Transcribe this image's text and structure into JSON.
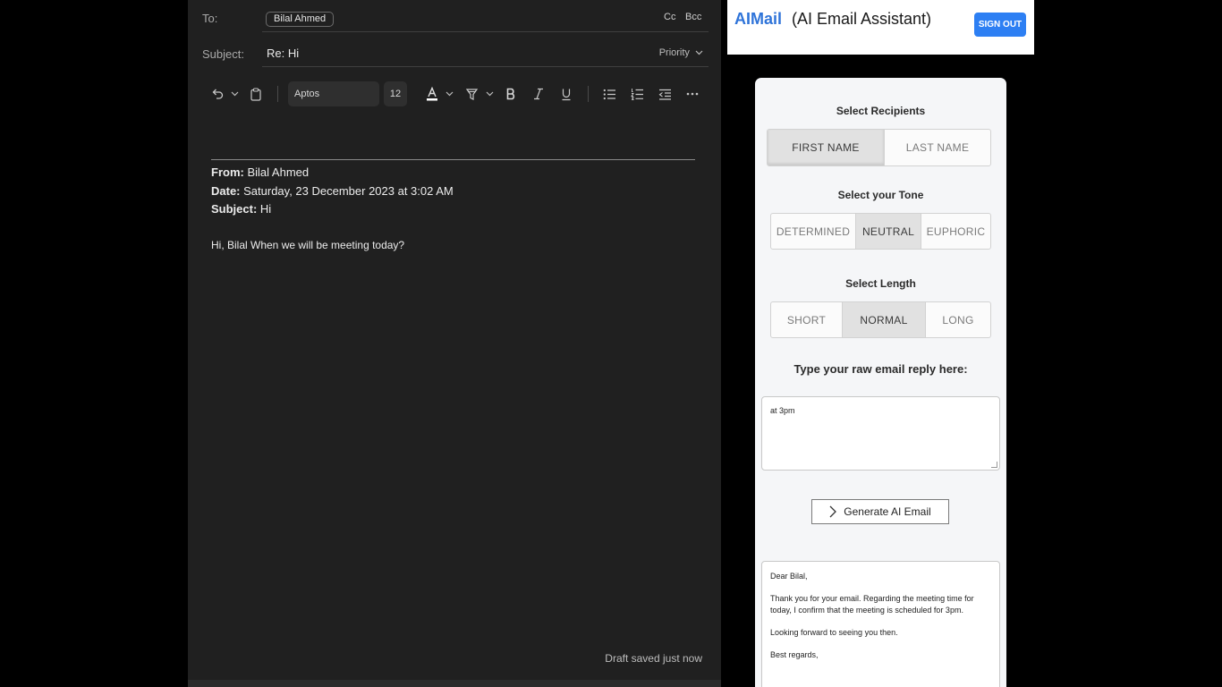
{
  "compose": {
    "to_label": "To:",
    "recipient_chip": "Bilal Ahmed",
    "cc_label": "Cc",
    "bcc_label": "Bcc",
    "subject_label": "Subject:",
    "subject_value": "Re: Hi",
    "priority_label": "Priority",
    "toolbar": {
      "font_name": "Aptos",
      "font_size": "12",
      "icons": [
        "undo-icon",
        "clipboard-icon",
        "font-color-icon",
        "highlight-icon",
        "bold-icon",
        "italic-icon",
        "underline-icon",
        "bullet-list-icon",
        "numbered-list-icon",
        "outdent-icon",
        "more-icon"
      ]
    },
    "quote": {
      "from_label": "From:",
      "from_value": " Bilal Ahmed",
      "date_label": "Date:",
      "date_value": " Saturday, 23 December 2023 at 3:02 AM",
      "subject_label": "Subject:",
      "subject_value": " Hi"
    },
    "body": "Hi, Bilal When we will be meeting today?",
    "draft_status": "Draft saved just now"
  },
  "ai_panel": {
    "brand": "AIMail",
    "brand_sub": "(AI Email Assistant)",
    "signout": "SIGN OUT",
    "recipients": {
      "title": "Select Recipients",
      "options": [
        "FIRST NAME",
        "LAST NAME"
      ],
      "selected": "FIRST NAME"
    },
    "tone": {
      "title": "Select your Tone",
      "options": [
        "DETERMINED",
        "NEUTRAL",
        "EUPHORIC"
      ],
      "selected": "NEUTRAL"
    },
    "length": {
      "title": "Select Length",
      "options": [
        "SHORT",
        "NORMAL",
        "LONG"
      ],
      "selected": "NORMAL"
    },
    "raw_title": "Type your raw email reply here:",
    "raw_value": "at 3pm",
    "generate_label": "Generate AI Email",
    "output": {
      "greeting": "Dear Bilal,",
      "para1": "Thank you for your email. Regarding the meeting time for today, I confirm that the meeting is scheduled for 3pm.",
      "para2": "Looking forward to seeing you then.",
      "closing": "Best regards,"
    }
  },
  "colors": {
    "compose_bg": "#202020",
    "accent_blue": "#2d7ff3",
    "brand_blue": "#2f74d9",
    "panel_bg": "#f5f6f8"
  }
}
